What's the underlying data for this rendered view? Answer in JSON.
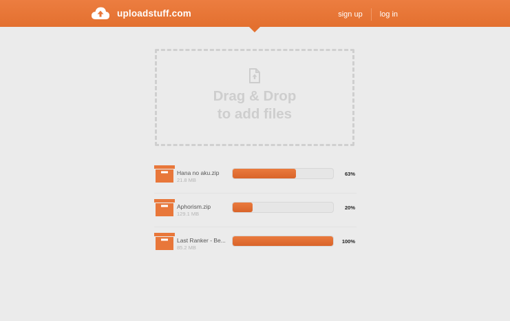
{
  "brand": {
    "name": "uploadstuff.com",
    "logo_icon": "cloud-upload-icon"
  },
  "nav": {
    "signup": "sign up",
    "login": "log in"
  },
  "dropzone": {
    "line1": "Drag & Drop",
    "line2": "to add files",
    "icon": "file-add-icon"
  },
  "colors": {
    "accent": "#e8773a",
    "background": "#ebebeb"
  },
  "files": [
    {
      "name": "Hana no aku.zip",
      "size": "21.8 MB",
      "progress": 0.63,
      "percent_label": "63%",
      "icon": "box-icon"
    },
    {
      "name": "Aphorism.zip",
      "size": "129.1 MB",
      "progress": 0.2,
      "percent_label": "20%",
      "icon": "box-icon"
    },
    {
      "name": "Last Ranker - Be...",
      "size": "85.2 MB",
      "progress": 1.0,
      "percent_label": "100%",
      "icon": "box-icon"
    }
  ]
}
